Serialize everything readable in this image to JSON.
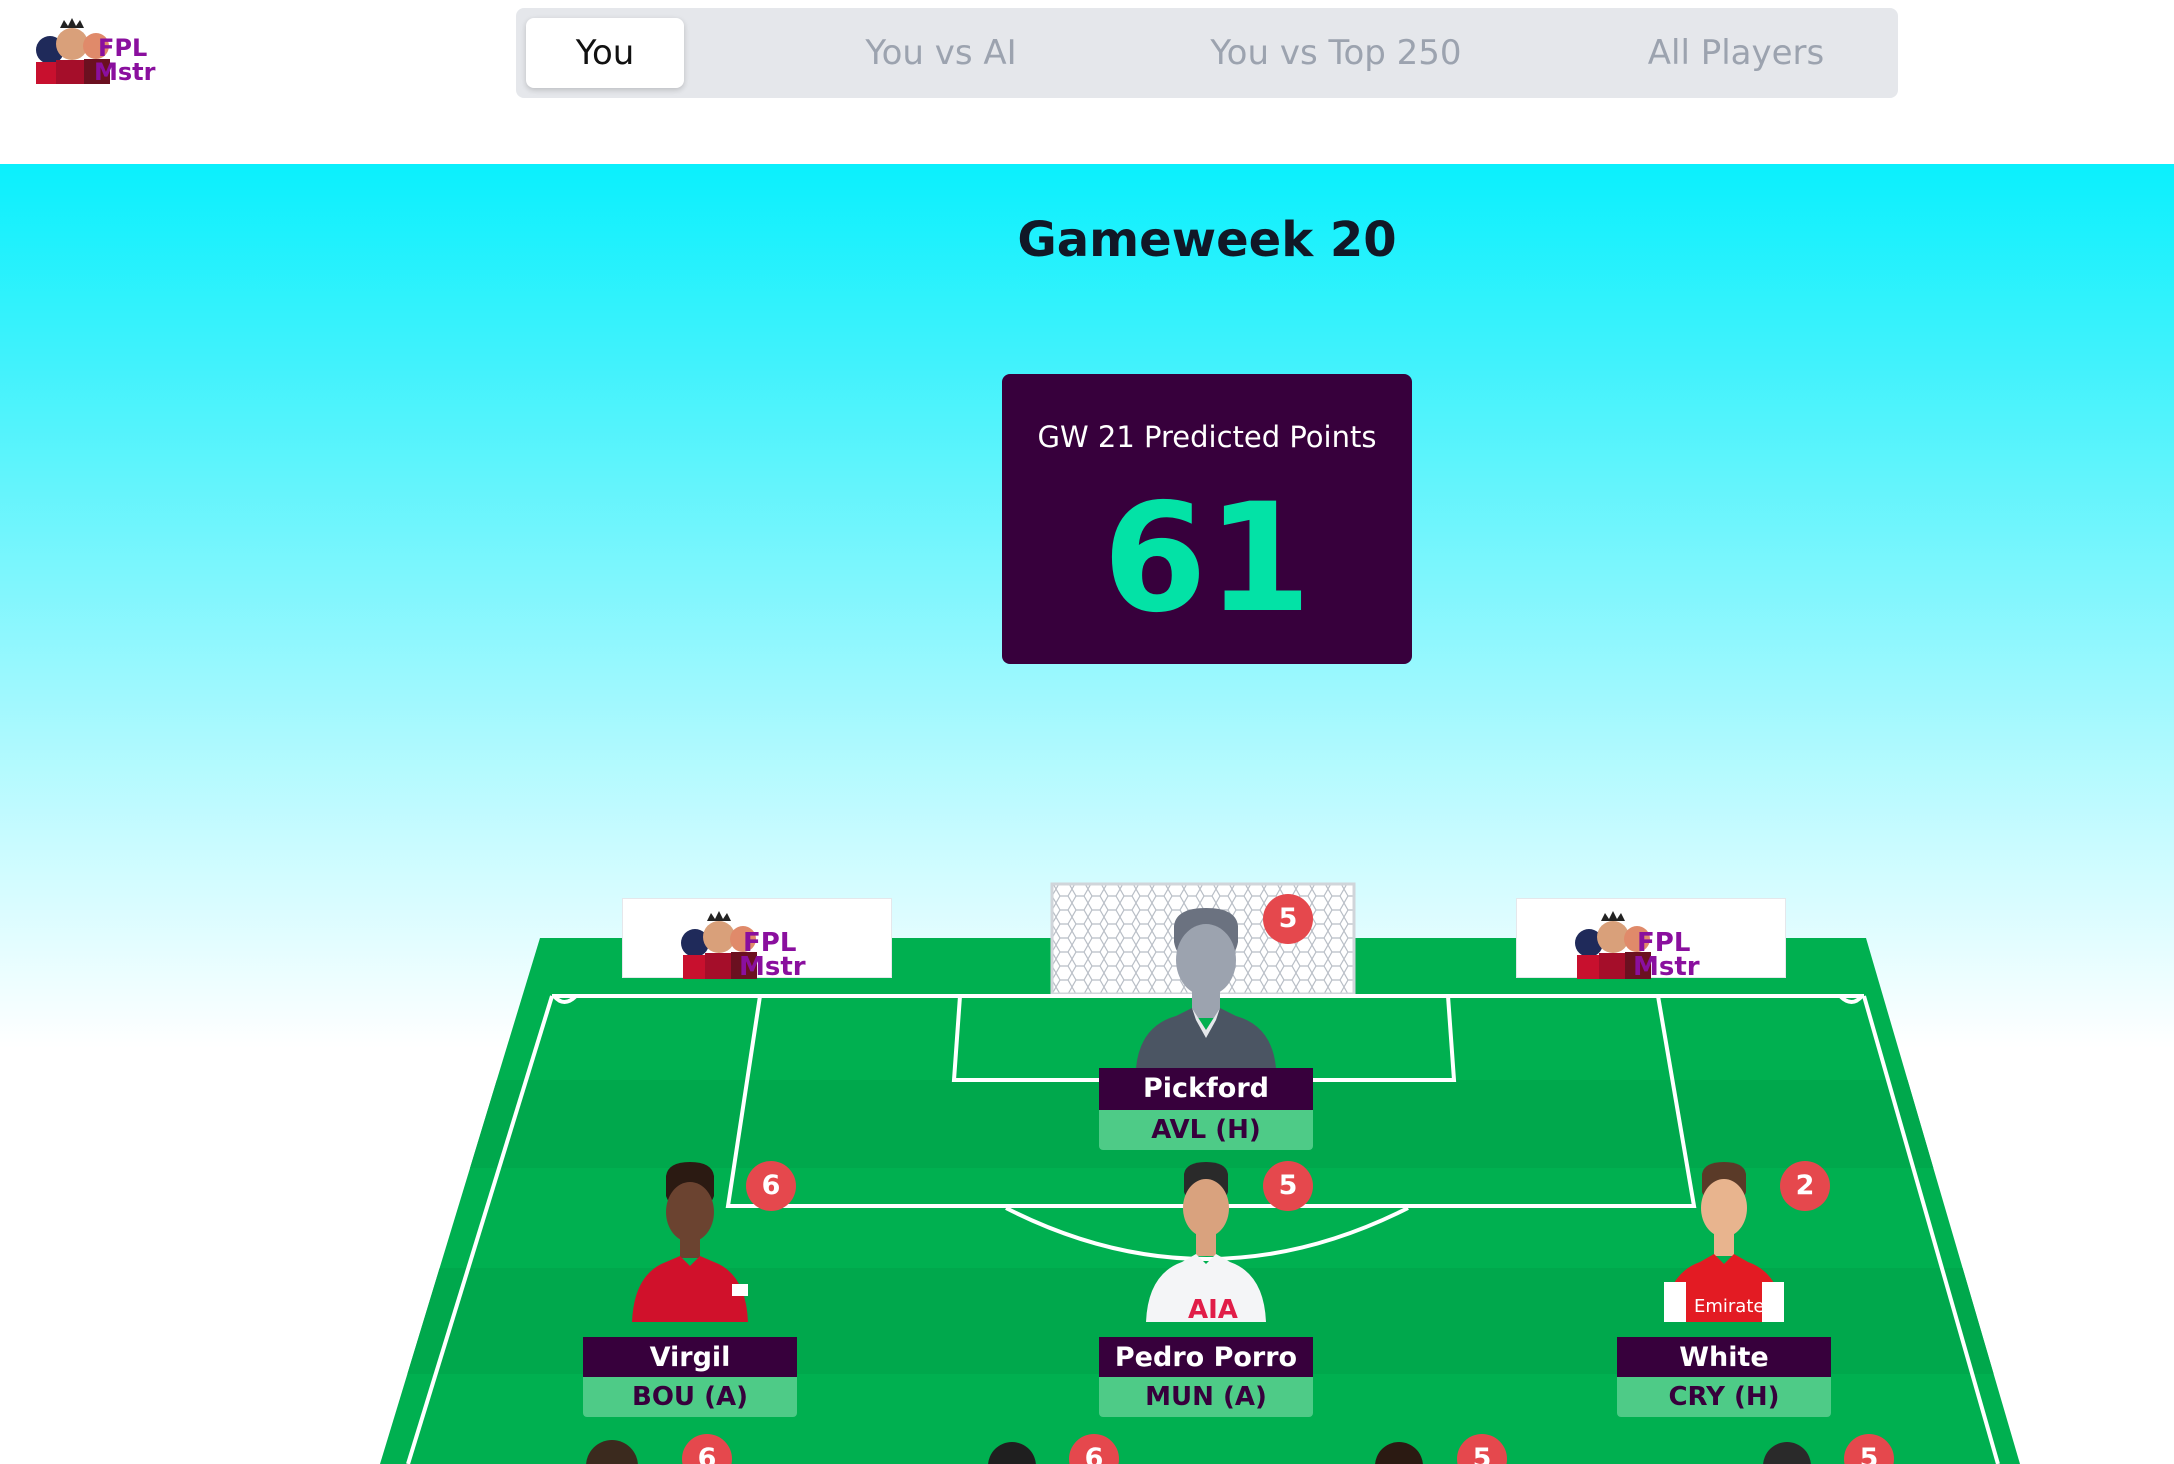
{
  "header": {
    "logo_text_line1": "FPL",
    "logo_text_line2": "Mstr",
    "tabs": [
      {
        "label": "You",
        "active": true
      },
      {
        "label": "You vs AI",
        "active": false
      },
      {
        "label": "You vs Top 250",
        "active": false
      },
      {
        "label": "All Players",
        "active": false
      }
    ]
  },
  "main": {
    "gameweek_title": "Gameweek 20",
    "predicted_card": {
      "label": "GW 21 Predicted Points",
      "value": "61"
    }
  },
  "colors": {
    "brand_purple": "#37003c",
    "points_green": "#03e2a6",
    "pitch_green": "#00b050",
    "badge_red": "#e5484d",
    "fixture_green": "#4ecb87"
  },
  "pitch": {
    "ad_boards": [
      {
        "line1": "FPL",
        "line2": "Mstr"
      },
      {
        "line1": "FPL",
        "line2": "Mstr"
      }
    ],
    "players": [
      {
        "name": "Pickford",
        "fixture": "AVL (H)",
        "points": "5",
        "kit": "goalkeeper-silhouette"
      },
      {
        "name": "Virgil",
        "fixture": "BOU (A)",
        "points": "6",
        "kit": "liverpool-red"
      },
      {
        "name": "Pedro Porro",
        "fixture": "MUN (A)",
        "points": "5",
        "kit": "tottenham-white"
      },
      {
        "name": "White",
        "fixture": "CRY (H)",
        "points": "2",
        "kit": "arsenal-red"
      }
    ],
    "next_row_points": [
      "6",
      "6",
      "5",
      "5"
    ]
  }
}
